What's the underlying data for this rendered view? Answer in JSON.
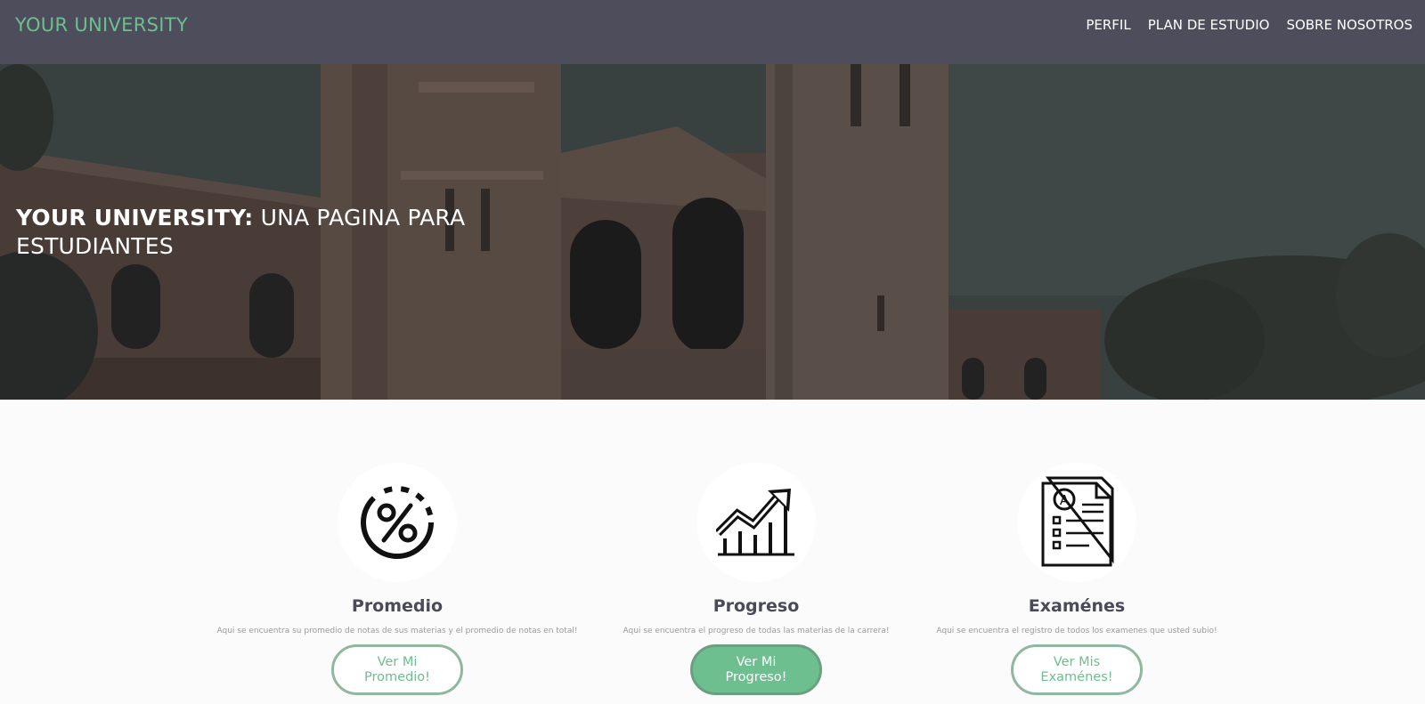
{
  "navbar": {
    "brand": "YOUR UNIVERSITY",
    "links": [
      "PERFIL",
      "PLAN DE ESTUDIO",
      "SOBRE NOSOTROS"
    ]
  },
  "hero": {
    "title_bold": "YOUR UNIVERSITY:",
    "title_rest": " UNA PAGINA PARA ESTUDIANTES"
  },
  "features": [
    {
      "icon": "percent-icon",
      "title": "Promedio",
      "description": "Aqui se encuentra su promedio de notas de sus materias y el promedio de notas en total!",
      "button": "Ver Mi Promedio!"
    },
    {
      "icon": "growth-chart-icon",
      "title": "Progreso",
      "description": "Aqui se encuentra el progreso de todas las materias de la carrera!",
      "button": "Ver Mi Progreso!"
    },
    {
      "icon": "exam-document-icon",
      "title": "Examénes",
      "description": "Aqui se encuentra el registro de todos los examenes que usted subio!",
      "button": "Ver Mis Examénes!"
    }
  ],
  "colors": {
    "navbar_bg": "#4d4d5c",
    "accent_green": "#6dbf8f",
    "page_bg": "#fbfbfb"
  }
}
